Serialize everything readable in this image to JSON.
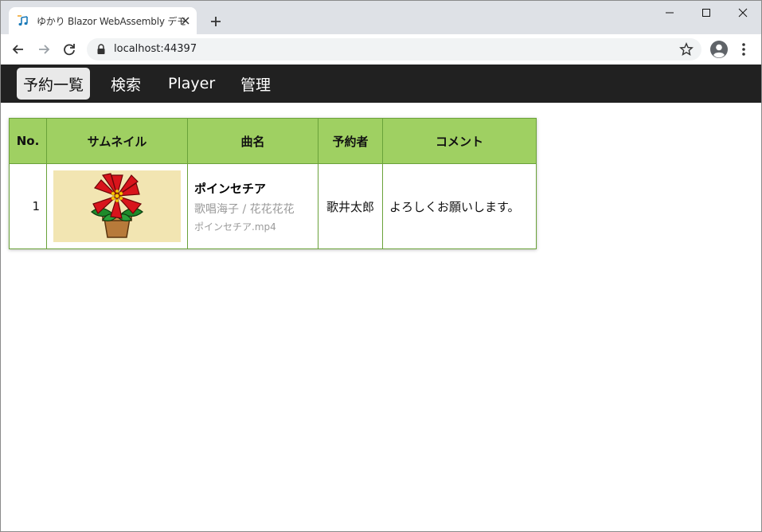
{
  "browser": {
    "tab_title": "ゆかり Blazor WebAssembly デモ",
    "url": "localhost:44397"
  },
  "nav": {
    "items": [
      {
        "label": "予約一覧",
        "active": true
      },
      {
        "label": "検索",
        "active": false
      },
      {
        "label": "Player",
        "active": false
      },
      {
        "label": "管理",
        "active": false
      }
    ]
  },
  "table": {
    "headers": [
      "No.",
      "サムネイル",
      "曲名",
      "予約者",
      "コメント"
    ],
    "rows": [
      {
        "no": "1",
        "thumbnail_icon": "poinsettia-image",
        "song_title": "ポインセチア",
        "song_artist": "歌唱海子 / 花花花花",
        "song_file": "ポインセチア.mp4",
        "user": "歌井太郎",
        "comment": "よろしくお願いします。"
      }
    ]
  },
  "colors": {
    "nav_bg": "#212121",
    "header_bg": "#9fd062",
    "border": "#6aa23a"
  }
}
